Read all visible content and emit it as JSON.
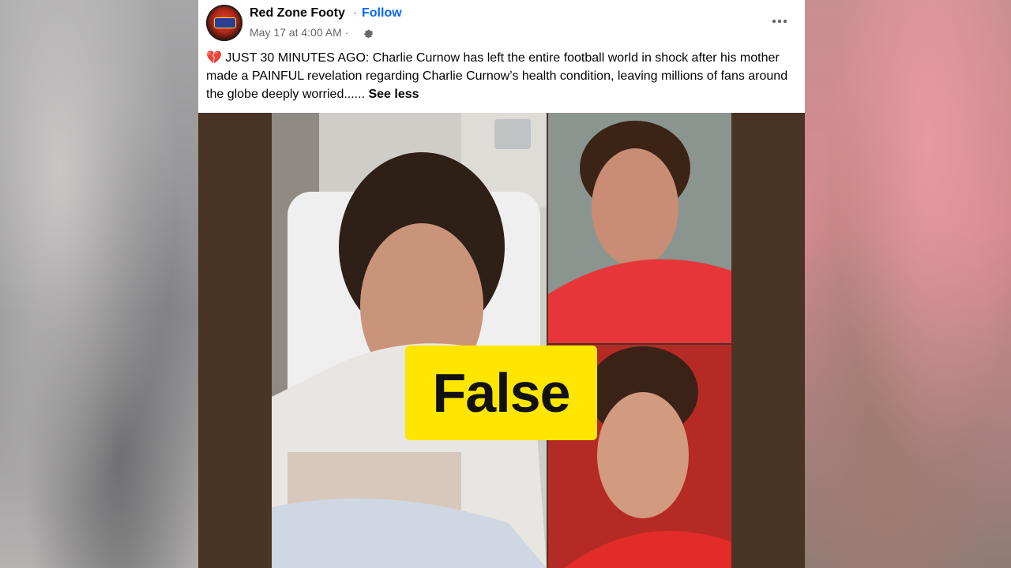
{
  "post": {
    "page_name": "Red Zone Footy",
    "separator": "·",
    "follow_label": "Follow",
    "timestamp": "May 17 at 4:00 AM ·",
    "caption_text": "JUST 30 MINUTES AGO: Charlie Curnow has left the entire football world in shock after his mother made a PAINFUL revelation regarding Charlie Curnow’s health condition, leaving millions of fans around the globe deeply worried......",
    "caption_emoji": "💔",
    "see_less_label": "See less"
  },
  "media": {
    "verdict_label": "False"
  },
  "icons": {
    "more": "more-options-icon",
    "settings": "gear-icon",
    "emoji": "broken-heart-icon"
  },
  "colors": {
    "link": "#0866ff",
    "verdict_bg": "#ffe600",
    "media_bg": "#4a3426"
  }
}
